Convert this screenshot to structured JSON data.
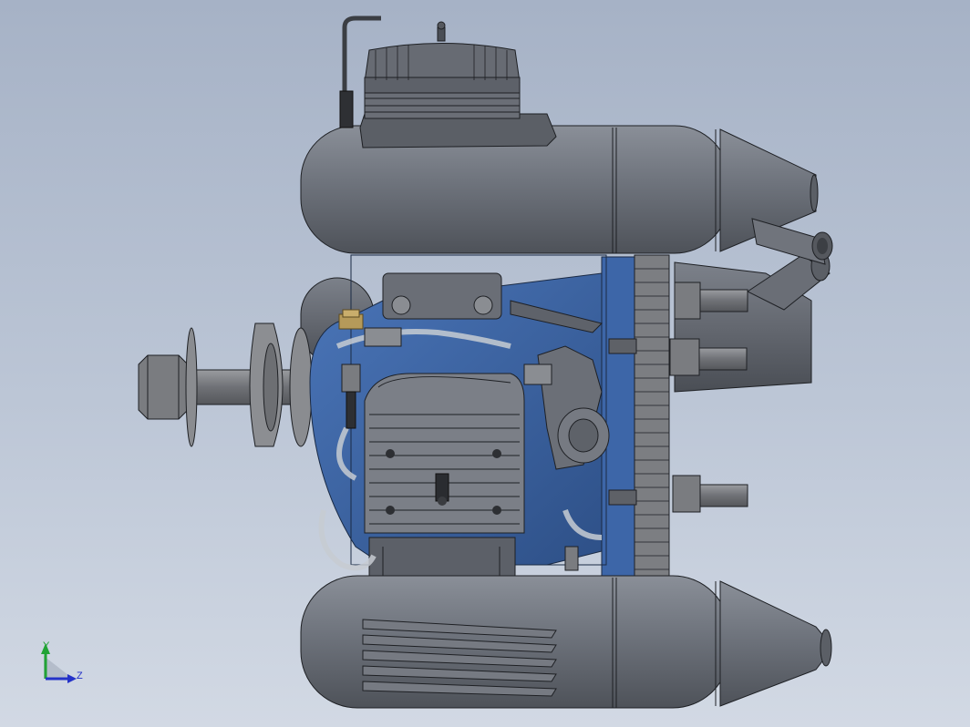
{
  "viewport": {
    "background_top": "#a6b2c6",
    "background_bottom": "#d2d9e4"
  },
  "colors": {
    "body_gray": "#6e737c",
    "body_gray_light": "#8a8f98",
    "body_gray_dark": "#4a4e55",
    "accent_blue": "#3d66a8",
    "accent_blue_dark": "#2d4f86",
    "steel": "#7d7f82",
    "brass": "#b59a5a",
    "tube": "#c7ccd2",
    "axis_y": "#21a335",
    "axis_z": "#2432c8"
  },
  "triad": {
    "y_label": "Y",
    "z_label": "Z"
  }
}
